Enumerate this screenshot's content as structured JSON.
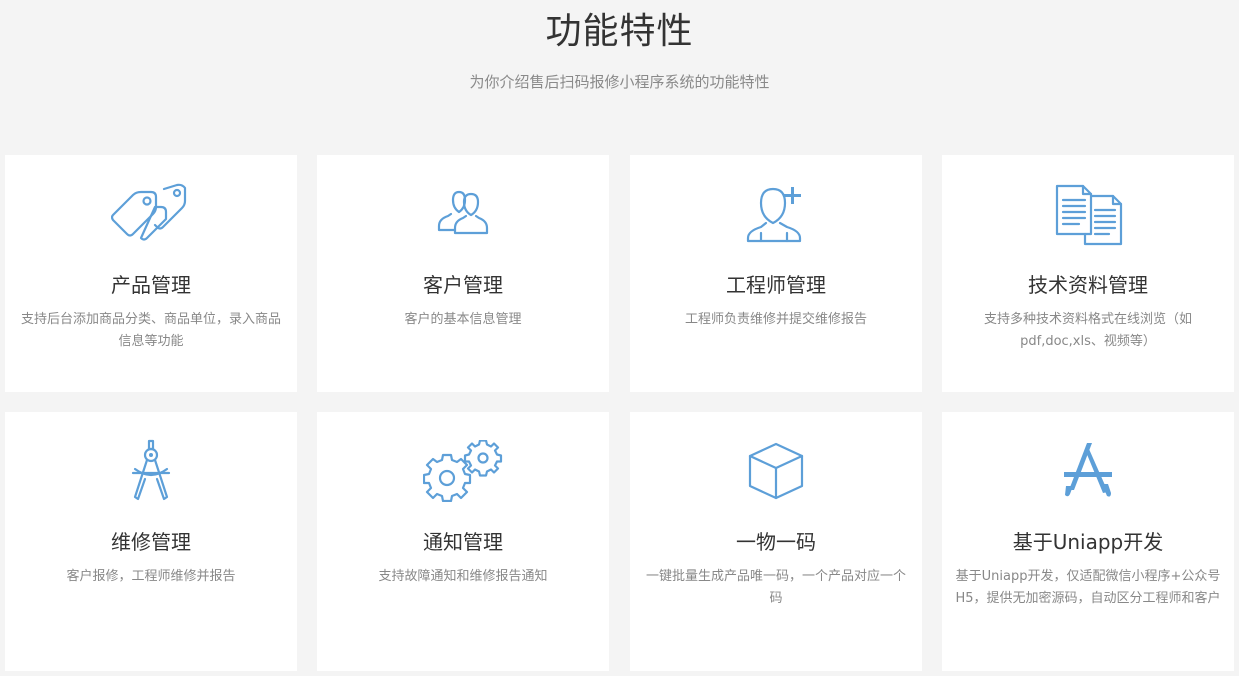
{
  "header": {
    "title": "功能特性",
    "subtitle": "为你介绍售后扫码报修小程序系统的功能特性"
  },
  "accent_color": "#5d9fd8",
  "features": [
    {
      "icon": "price-tags-icon",
      "title": "产品管理",
      "desc": "支持后台添加商品分类、商品单位，录入商品信息等功能"
    },
    {
      "icon": "users-icon",
      "title": "客户管理",
      "desc": "客户的基本信息管理"
    },
    {
      "icon": "add-user-icon",
      "title": "工程师管理",
      "desc": "工程师负责维修并提交维修报告"
    },
    {
      "icon": "documents-icon",
      "title": "技术资料管理",
      "desc": "支持多种技术资料格式在线浏览（如pdf,doc,xls、视频等）"
    },
    {
      "icon": "compass-icon",
      "title": "维修管理",
      "desc": "客户报修，工程师维修并报告"
    },
    {
      "icon": "gears-icon",
      "title": "通知管理",
      "desc": "支持故障通知和维修报告通知"
    },
    {
      "icon": "cube-icon",
      "title": "一物一码",
      "desc": "一键批量生成产品唯一码，一个产品对应一个码"
    },
    {
      "icon": "app-store-icon",
      "title": "基于Uniapp开发",
      "desc": "基于Uniapp开发，仅适配微信小程序+公众号H5，提供无加密源码，自动区分工程师和客户"
    }
  ]
}
